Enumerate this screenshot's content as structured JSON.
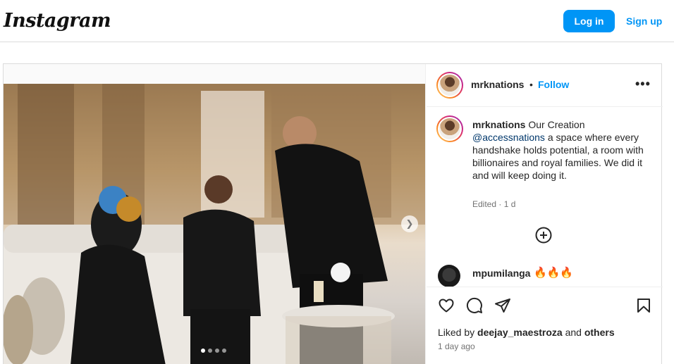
{
  "header": {
    "logo_text": "Instagram",
    "login_label": "Log in",
    "signup_label": "Sign up"
  },
  "post": {
    "username": "mrknations",
    "separator": "•",
    "follow_label": "Follow",
    "more_icon": "more-horizontal-icon",
    "caption": {
      "username": "mrknations",
      "text_before": "Our Creation",
      "mention": "@accessnations",
      "text_after": "a space where every handshake holds potential, a room with billionaires and royal families. We did it and will keep doing it."
    },
    "edited_text": "Edited · 1 d",
    "load_more_icon": "plus-circle-icon",
    "comments": [
      {
        "username": "mpumilanga",
        "text": "🔥🔥🔥"
      }
    ],
    "carousel": {
      "slides": 4,
      "active_index": 0,
      "next_icon": "chevron-right-icon"
    },
    "actions": {
      "like_icon": "heart-icon",
      "comment_icon": "comment-icon",
      "share_icon": "send-icon",
      "save_icon": "bookmark-icon"
    },
    "liked_by": {
      "prefix": "Liked by",
      "user": "deejay_maestroza",
      "conjunction": "and",
      "others": "others"
    },
    "time_ago": "1 day ago"
  },
  "colors": {
    "accent": "#0095f6",
    "border": "#dbdbdb",
    "text": "#262626",
    "secondary_text": "#737373"
  }
}
